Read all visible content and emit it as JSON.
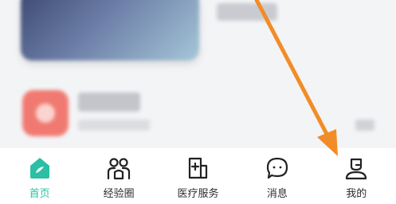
{
  "tabbar": {
    "accent_color": "#2bbfa5",
    "items": [
      {
        "label": "首页",
        "icon": "home-icon",
        "active": true
      },
      {
        "label": "经验圈",
        "icon": "community-icon",
        "active": false
      },
      {
        "label": "医疗服务",
        "icon": "medical-service-icon",
        "active": false
      },
      {
        "label": "消息",
        "icon": "message-icon",
        "active": false
      },
      {
        "label": "我的",
        "icon": "profile-icon",
        "active": false
      }
    ]
  },
  "annotation": {
    "color": "#f28c28",
    "type": "arrow pointing to 我的 tab"
  }
}
